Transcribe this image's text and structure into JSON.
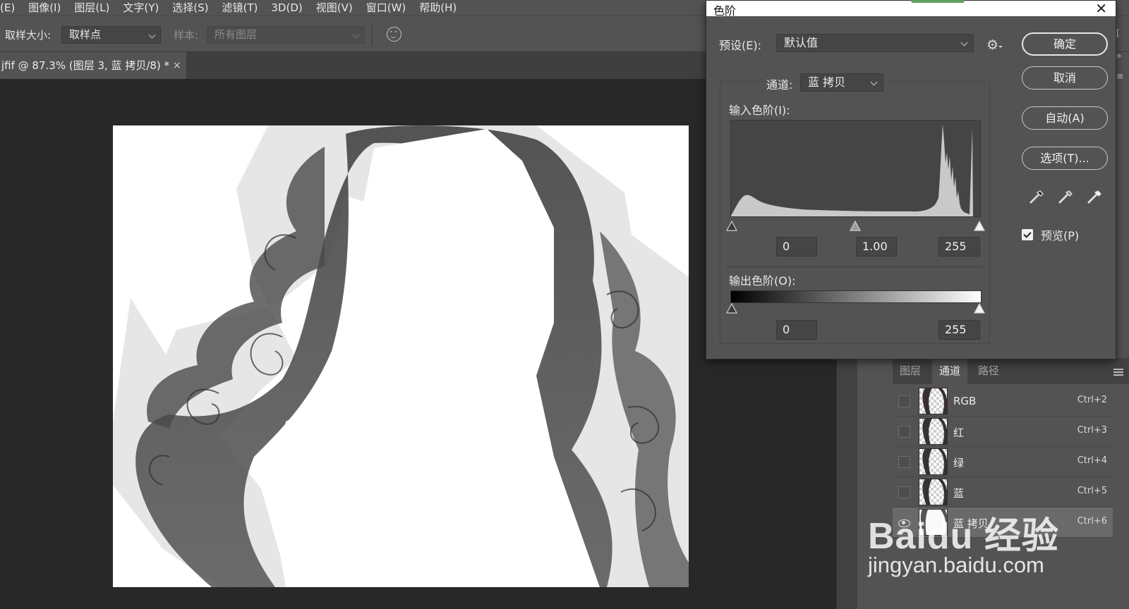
{
  "menu": [
    "(E)",
    "图像(I)",
    "图层(L)",
    "文字(Y)",
    "选择(S)",
    "滤镜(T)",
    "3D(D)",
    "视图(V)",
    "窗口(W)",
    "帮助(H)"
  ],
  "options": {
    "sample_size_label": "取样大小:",
    "sample_size_value": "取样点",
    "sample_label": "样本:",
    "sample_value": "所有图层"
  },
  "document_tab": {
    "title": "jfif @ 87.3% (图层 3, 蓝 拷贝/8) *",
    "close": "×"
  },
  "levels_dialog": {
    "title": "色阶",
    "close": "✕",
    "preset_label": "预设(E):",
    "preset_value": "默认值",
    "channel_label": "通道:",
    "channel_value": "蓝 拷贝",
    "input_label": "输入色阶(I):",
    "input_black": "0",
    "input_gamma": "1.00",
    "input_white": "255",
    "output_label": "输出色阶(O):",
    "output_black": "0",
    "output_white": "255",
    "buttons": {
      "ok": "确定",
      "cancel": "取消",
      "auto": "自动(A)",
      "options": "选项(T)..."
    },
    "preview_label": "预览(P)",
    "preview_checked": true
  },
  "channels_panel": {
    "tabs": [
      "图层",
      "通道",
      "路径"
    ],
    "active_tab": "通道",
    "channels": [
      {
        "name": "RGB",
        "shortcut": "Ctrl+2",
        "selected": false
      },
      {
        "name": "红",
        "shortcut": "Ctrl+3",
        "selected": false
      },
      {
        "name": "绿",
        "shortcut": "Ctrl+4",
        "selected": false
      },
      {
        "name": "蓝",
        "shortcut": "Ctrl+5",
        "selected": false
      },
      {
        "name": "蓝 拷贝",
        "shortcut": "Ctrl+6",
        "selected": true
      }
    ]
  },
  "watermark": {
    "main": "Baidu 经验",
    "sub": "jingyan.baidu.com"
  },
  "colors": {
    "panel_bg": "#535353",
    "app_bg": "#282828",
    "dialog_title_bg": "#ffffff"
  }
}
